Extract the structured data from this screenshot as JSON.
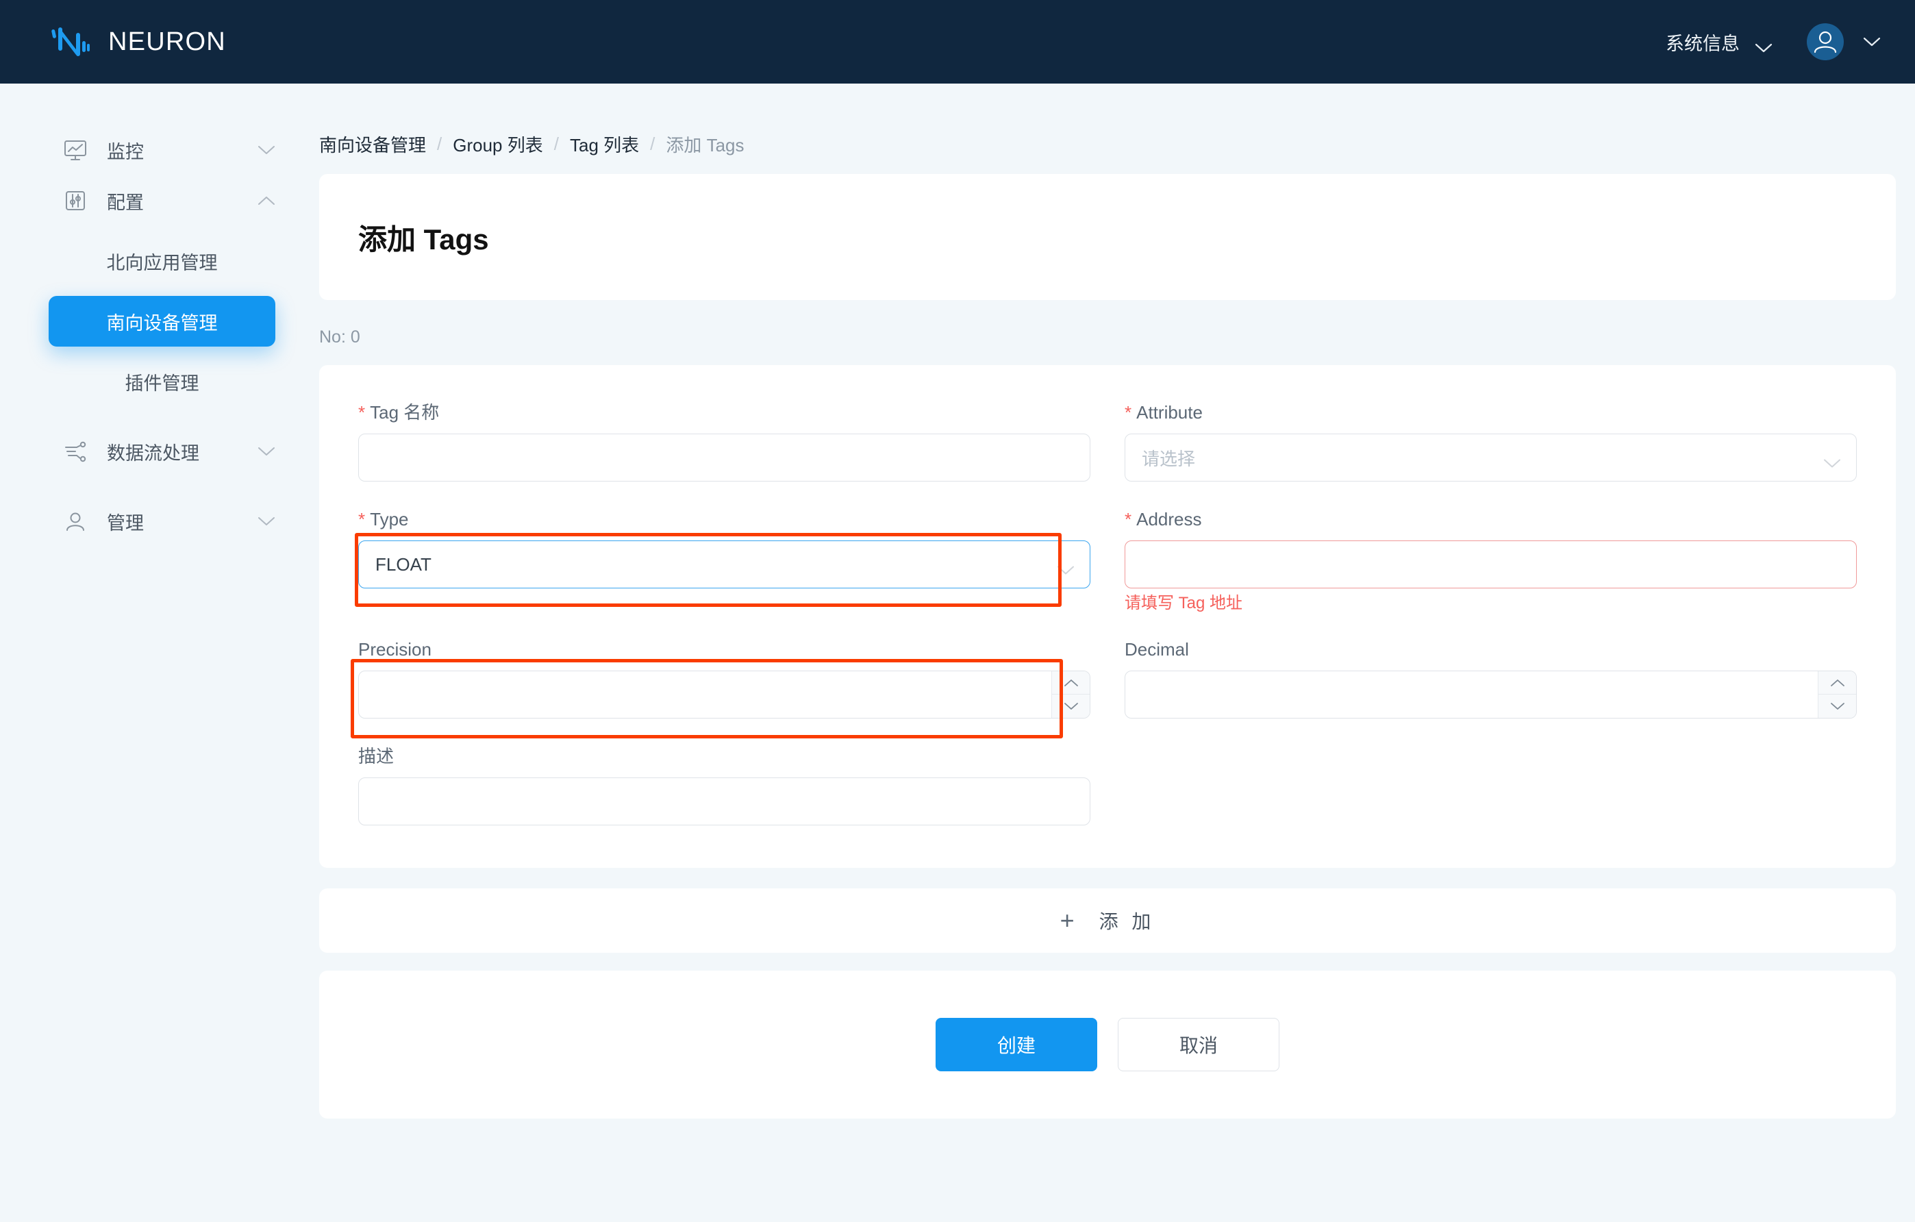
{
  "brand": {
    "name": "NEURON",
    "logo_icon": "neuron-logo-icon"
  },
  "topbar": {
    "system_info_label": "系统信息",
    "system_info_caret_icon": "chevron-down-icon",
    "avatar_icon": "user-avatar-icon",
    "avatar_caret_icon": "chevron-down-icon"
  },
  "sidebar": {
    "items": [
      {
        "label": "监控",
        "icon": "monitor-chart-icon",
        "caret": "chevron-down-icon",
        "expanded": false
      },
      {
        "label": "配置",
        "icon": "sliders-icon",
        "caret": "chevron-up-icon",
        "expanded": true
      },
      {
        "label": "数据流处理",
        "icon": "dataflow-icon",
        "caret": "chevron-down-icon",
        "expanded": false
      },
      {
        "label": "管理",
        "icon": "user-icon",
        "caret": "chevron-down-icon",
        "expanded": false
      }
    ],
    "config_children": [
      {
        "label": "北向应用管理",
        "active": false
      },
      {
        "label": "南向设备管理",
        "active": true
      },
      {
        "label": "插件管理",
        "active": false
      }
    ]
  },
  "breadcrumb": {
    "items": [
      "南向设备管理",
      "Group 列表",
      "Tag 列表",
      "添加 Tags"
    ],
    "separator": "/"
  },
  "page": {
    "title": "添加 Tags",
    "no_label": "No: 0"
  },
  "form": {
    "tag_name": {
      "label": "Tag 名称",
      "required": true,
      "value": "",
      "placeholder": ""
    },
    "attribute": {
      "label": "Attribute",
      "required": true,
      "value": "",
      "placeholder": "请选择",
      "caret_icon": "chevron-down-icon"
    },
    "type": {
      "label": "Type",
      "required": true,
      "value": "FLOAT",
      "caret_icon": "chevron-down-icon",
      "focused": true,
      "highlighted": true
    },
    "address": {
      "label": "Address",
      "required": true,
      "value": "",
      "placeholder": "",
      "error": "请填写 Tag 地址"
    },
    "precision": {
      "label": "Precision",
      "required": false,
      "value": "",
      "highlighted": true,
      "up_icon": "chevron-up-icon",
      "down_icon": "chevron-down-icon"
    },
    "decimal": {
      "label": "Decimal",
      "required": false,
      "value": "",
      "up_icon": "chevron-up-icon",
      "down_icon": "chevron-down-icon"
    },
    "description": {
      "label": "描述",
      "required": false,
      "value": "",
      "placeholder": ""
    }
  },
  "add_row": {
    "plus_icon": "plus-icon",
    "label": "添 加"
  },
  "actions": {
    "create_label": "创建",
    "cancel_label": "取消"
  },
  "colors": {
    "brand_dark": "#10273f",
    "accent_blue": "#1296f0",
    "focus_blue": "#3ba5ef",
    "error_red": "#f5605b",
    "highlight_orange": "#fa3c00",
    "page_bg": "#f2f7fa"
  }
}
